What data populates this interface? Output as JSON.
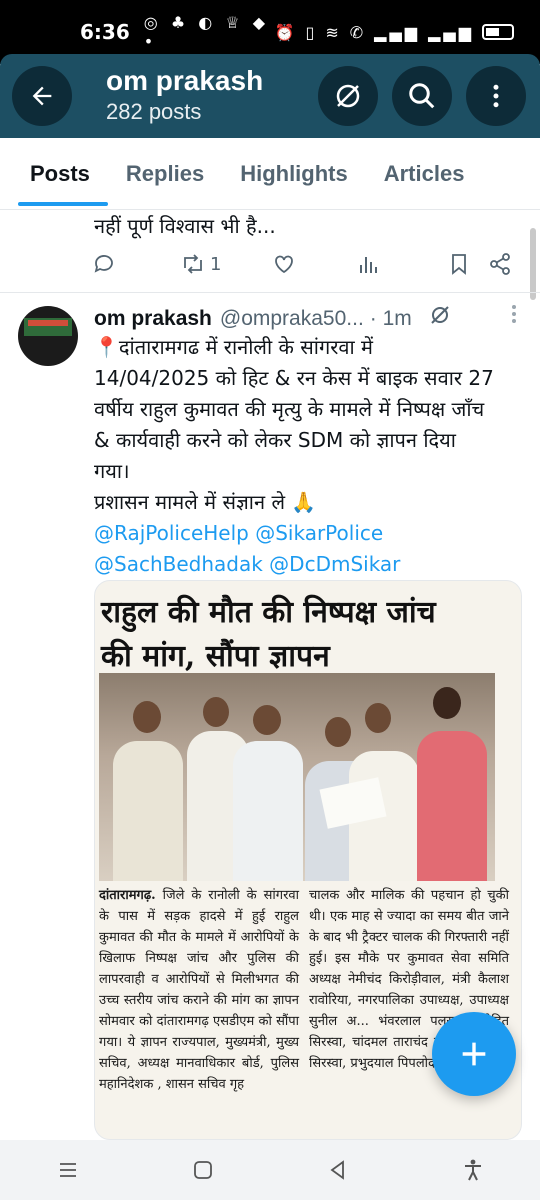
{
  "status_bar": {
    "time": "6:36",
    "left_icons": [
      "whatsapp-icon",
      "notification-icon",
      "sync-icon",
      "trophy-icon",
      "app-icon",
      "dot-icon"
    ],
    "right_icons": [
      "alarm-icon",
      "vibrate-icon",
      "wifi-icon",
      "call-icon",
      "signal-icon",
      "signal-icon",
      "battery-icon"
    ]
  },
  "header": {
    "profile_name": "om prakash",
    "post_count": "282 posts"
  },
  "tabs": [
    {
      "label": "Posts",
      "active": true
    },
    {
      "label": "Replies",
      "active": false
    },
    {
      "label": "Highlights",
      "active": false
    },
    {
      "label": "Articles",
      "active": false
    }
  ],
  "previous_post": {
    "text_tail": "नहीं पूर्ण विश्वास भी है...",
    "retweet_count": "1"
  },
  "tweet": {
    "author_name": "om prakash",
    "handle": "@ompraka50...",
    "time": "· 1m",
    "body_lines": [
      "📍दांतारामगढ में रानोली के सांगरवा में",
      "14/04/2025 को हिट & रन केस में बाइक सवार 27",
      "वर्षीय राहुल कुमावत की मृत्यु के मामले में निष्पक्ष जाँच",
      "& कार्यवाही करने को लेकर SDM को ज्ञापन दिया",
      "गया।",
      "प्रशासन मामले में संज्ञान ले 🙏"
    ],
    "mentions_line1": "@RajPoliceHelp @SikarPolice",
    "mentions_line2": "@SachBedhadak @DcDmSikar"
  },
  "news_clipping": {
    "headline_line1": "राहुल की मौत की निष्पक्ष जांच",
    "headline_line2": "की मांग, सौंपा ज्ञापन",
    "col1_lead": "दांतारामगढ़.",
    "col1_text": " जिले के रानोली के सांगरवा के पास में सड़क हादसे में हुई राहुल कुमावत की मौत के मामले में आरोपियों के खिलाफ निष्पक्ष जांच और पुलिस की लापरवाही व आरोपियों से मिलीभगत की उच्च स्तरीय जांच कराने की मांग का ज्ञापन सोमवार को दांतारामगढ़ एसडीएम को सौंपा गया। ये ज्ञापन राज्यपाल, मुख्यमंत्री, मुख्य सचिव, अध्यक्ष मानवाधिकार बोर्ड, पुलिस महानिदेशक , शासन सचिव गृह",
    "col2_text": "चालक और मालिक की पहचान हो चुकी थी। एक माह से ज्यादा का समय बीत जाने के बाद भी ट्रैक्टर चालक की गिरफ्तारी नहीं हुई। इस मौके पर कुमावत सेवा समिति अध्यक्ष नेमीचंद किरोड़ीवाल, मंत्री कैलाश रावोरिया, नगरपालिका उपाध्यक्ष, उपाध्यक्ष सुनील अ... भंवरलाल पलसाना, रोहित सिरस्वा, चांदमल ताराचंद कुमावत, चिरं... सिरस्वा, प्रभुदयाल पिपलोदा"
  },
  "colors": {
    "header_bg": "#1d4f63",
    "accent": "#1d9bf0",
    "text_primary": "#0f1419",
    "text_secondary": "#536471"
  },
  "fab": {
    "icon": "plus-icon"
  },
  "nav_bar": {
    "icons": [
      "recents-icon",
      "home-icon",
      "back-icon",
      "accessibility-icon"
    ]
  }
}
